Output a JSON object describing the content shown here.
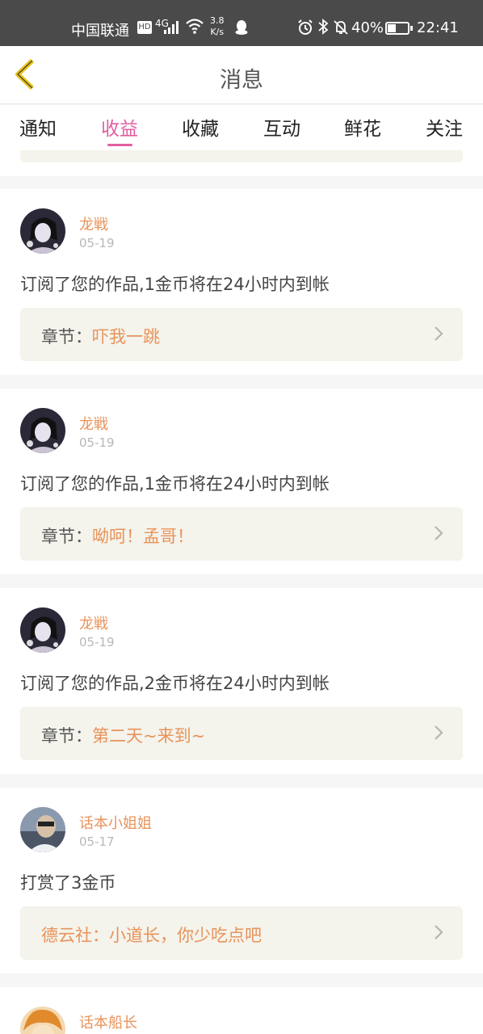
{
  "status_bar": {
    "carrier": "中国联通",
    "hd": "HD",
    "signal_type": "4G",
    "speed_value": "3.8",
    "speed_unit": "K/s",
    "battery": "40%",
    "time": "22:41"
  },
  "header": {
    "title": "消息"
  },
  "tabs": [
    {
      "label": "通知",
      "active": false
    },
    {
      "label": "收益",
      "active": true
    },
    {
      "label": "收藏",
      "active": false
    },
    {
      "label": "互动",
      "active": false
    },
    {
      "label": "鲜花",
      "active": false
    },
    {
      "label": "关注",
      "active": false
    }
  ],
  "chapter_prefix": "章节：",
  "messages": [
    {
      "user": "龙戦",
      "date": "05-19",
      "text": "订阅了您的作品,1金币将在24小时内到帐",
      "chapter": "吓我一跳"
    },
    {
      "user": "龙戦",
      "date": "05-19",
      "text": "订阅了您的作品,1金币将在24小时内到帐",
      "chapter": "呦呵！孟哥！"
    },
    {
      "user": "龙戦",
      "date": "05-19",
      "text": "订阅了您的作品,2金币将在24小时内到帐",
      "chapter": "第二天~来到~"
    },
    {
      "user": "话本小姐姐",
      "date": "05-17",
      "text": "打赏了3金币",
      "book": "德云社：小道长，你少吃点吧"
    },
    {
      "user": "话本船长"
    }
  ],
  "colors": {
    "accent": "#e05fa0",
    "name": "#e8935a",
    "back_icon": "#e6c21a"
  }
}
